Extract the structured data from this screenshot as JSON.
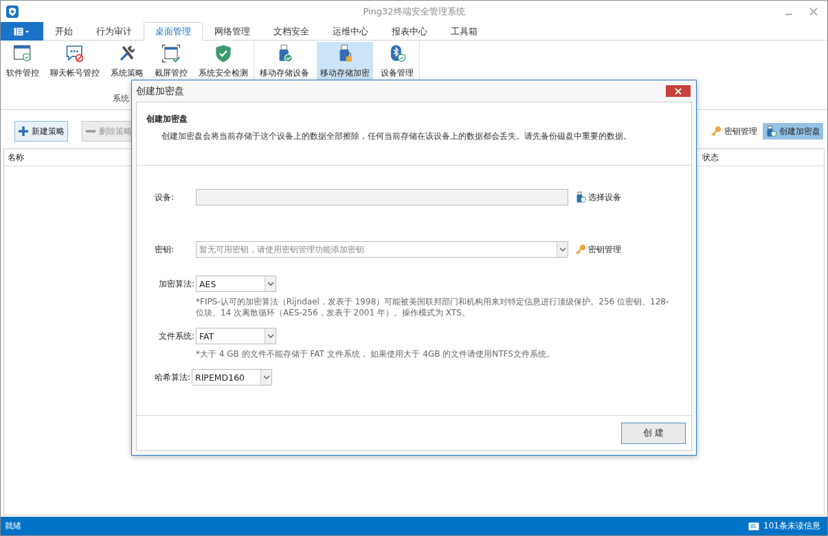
{
  "window": {
    "title": "Ping32终端安全管理系统"
  },
  "tabs": [
    {
      "label": "开始",
      "selected": false
    },
    {
      "label": "行为审计",
      "selected": false
    },
    {
      "label": "桌面管理",
      "selected": true
    },
    {
      "label": "网络管理",
      "selected": false
    },
    {
      "label": "文档安全",
      "selected": false
    },
    {
      "label": "运维中心",
      "selected": false
    },
    {
      "label": "报表中心",
      "selected": false
    },
    {
      "label": "工具箱",
      "selected": false
    }
  ],
  "ribbon": {
    "groups": [
      {
        "label": "系统",
        "items": [
          {
            "label": "软件管控",
            "selected": false
          },
          {
            "label": "聊天帐号管控",
            "selected": false
          },
          {
            "label": "系统策略",
            "selected": false
          },
          {
            "label": "截屏管控",
            "selected": false
          },
          {
            "label": "系统安全检测",
            "selected": false
          }
        ]
      },
      {
        "items": [
          {
            "label": "移动存储设备",
            "selected": false
          },
          {
            "label": "移动存储加密",
            "selected": true
          },
          {
            "label": "设备管理",
            "selected": false
          }
        ]
      }
    ]
  },
  "toolbar": {
    "left": [
      {
        "label": "新建策略",
        "disabled": false
      },
      {
        "label": "删除策略",
        "disabled": true
      }
    ],
    "right": [
      {
        "label": "密钥管理",
        "selected": false
      },
      {
        "label": "创建加密盘",
        "selected": true
      }
    ]
  },
  "table": {
    "columns": [
      "名称",
      "状态"
    ]
  },
  "dialog": {
    "title": "创建加密盘",
    "heading": "创建加密盘",
    "description": "创建加密盘会将当前存储于这个设备上的数据全部擦除，任何当前存储在该设备上的数据都会丢失。请先备份磁盘中重要的数据。",
    "fields": [
      {
        "kind": "text",
        "label": "设备:",
        "action": "选择设备"
      },
      {
        "kind": "combo",
        "label": "密钥:",
        "placeholder": "暂无可用密钥，请使用密钥管理功能添加密钥",
        "action": "密钥管理"
      },
      {
        "kind": "select",
        "label": "加密算法:",
        "value": "AES",
        "note": "*FIPS-认可的加密算法（Rijndael，发表于 1998）可能被美国联邦部门和机构用来对特定信息进行顶级保护。256 位密钥、128-位块、14 次离散循环（AES-256，发表于 2001 年）。操作模式为 XTS。"
      },
      {
        "kind": "select",
        "label": "文件系统:",
        "value": "FAT",
        "note": "*大于 4 GB 的文件不能存储于 FAT 文件系统， 如果使用大于 4GB 的文件请使用NTFS文件系统。"
      },
      {
        "kind": "select",
        "label": "哈希算法:",
        "value": "RIPEMD160"
      }
    ],
    "button": "创 建"
  },
  "status_bar": {
    "left": "就绪",
    "right": "101条未读信息"
  }
}
